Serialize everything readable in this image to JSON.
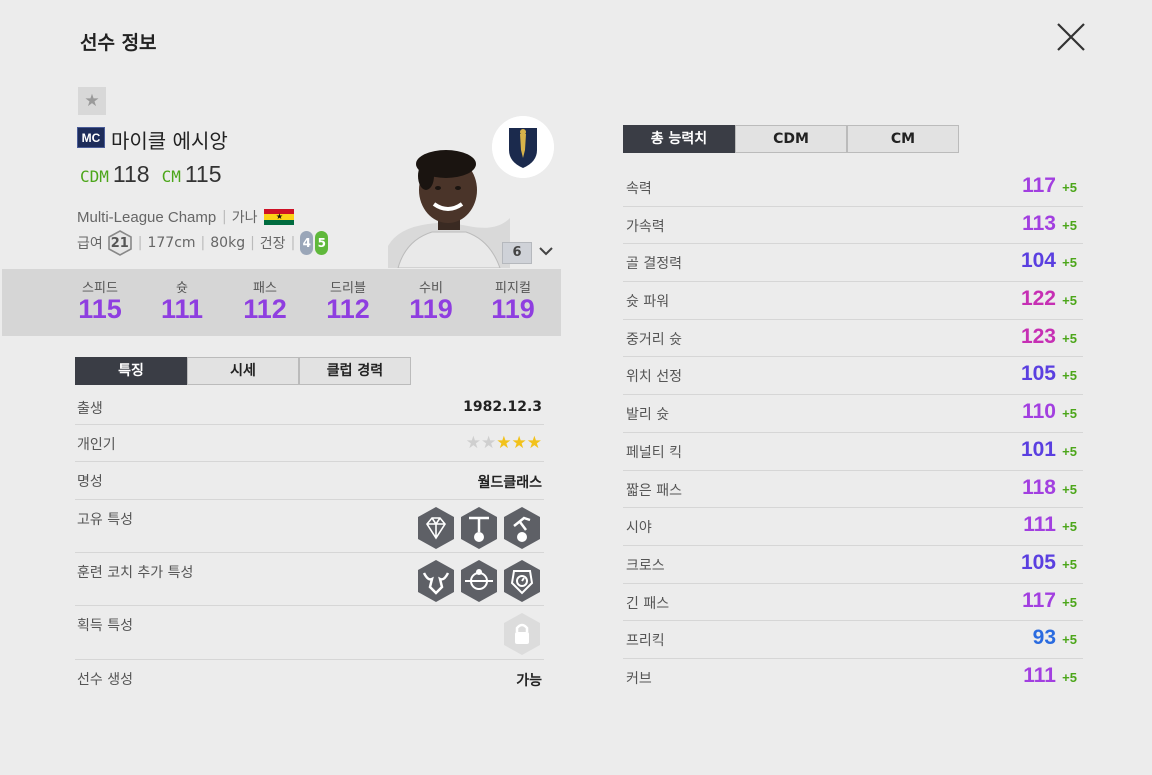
{
  "window": {
    "title": "선수 정보"
  },
  "player": {
    "season_badge": "MC",
    "name": "마이클 에시앙",
    "positions": [
      {
        "pos": "CDM",
        "ovr": "118"
      },
      {
        "pos": "CM",
        "ovr": "115"
      }
    ],
    "league": "Multi-League Champions",
    "nationality": "가나",
    "salary_label": "급여",
    "salary": "21",
    "height": "177cm",
    "weight": "80kg",
    "status_label": "건장",
    "weak_foot_left": "4",
    "strong_foot_right": "5",
    "enhance_level": "6"
  },
  "summary_stats": [
    {
      "label": "스피드",
      "value": "115"
    },
    {
      "label": "슛",
      "value": "111"
    },
    {
      "label": "패스",
      "value": "112"
    },
    {
      "label": "드리블",
      "value": "112"
    },
    {
      "label": "수비",
      "value": "119"
    },
    {
      "label": "피지컬",
      "value": "119"
    }
  ],
  "left_tabs": [
    {
      "label": "특징",
      "active": true
    },
    {
      "label": "시세",
      "active": false
    },
    {
      "label": "클럽 경력",
      "active": false
    }
  ],
  "details": {
    "birth": {
      "label": "출생",
      "value": "1982.12.3"
    },
    "popularity": {
      "label": "개인기",
      "stars": 3,
      "max": 5
    },
    "reputation": {
      "label": "명성",
      "value": "월드클래스"
    },
    "unique_traits": {
      "label": "고유 특성",
      "icons": [
        "diamond-trait-icon",
        "goalpost-trait-icon",
        "bicycle-kick-trait-icon"
      ]
    },
    "coach_traits": {
      "label": "훈련 코치 추가 특성",
      "icons": [
        "bull-trait-icon",
        "ball-center-trait-icon",
        "stopwatch-trait-icon"
      ]
    },
    "acquired_traits": {
      "label": "획득 특성",
      "icons": [
        "lock-icon"
      ]
    },
    "creation": {
      "label": "선수 생성",
      "value": "가능"
    }
  },
  "right_tabs": [
    {
      "label": "총 능력치",
      "active": true
    },
    {
      "label": "CDM",
      "active": false
    },
    {
      "label": "CM",
      "active": false
    }
  ],
  "attributes": [
    {
      "label": "속력",
      "value": "117",
      "bonus": "+5",
      "color": "#a23fe0"
    },
    {
      "label": "가속력",
      "value": "113",
      "bonus": "+5",
      "color": "#a23fe0"
    },
    {
      "label": "골 결정력",
      "value": "104",
      "bonus": "+5",
      "color": "#5a3fe0"
    },
    {
      "label": "슛 파워",
      "value": "122",
      "bonus": "+5",
      "color": "#c62fb4"
    },
    {
      "label": "중거리 슛",
      "value": "123",
      "bonus": "+5",
      "color": "#c62fb4"
    },
    {
      "label": "위치 선정",
      "value": "105",
      "bonus": "+5",
      "color": "#5a3fe0"
    },
    {
      "label": "발리 슛",
      "value": "110",
      "bonus": "+5",
      "color": "#a23fe0"
    },
    {
      "label": "페널티 킥",
      "value": "101",
      "bonus": "+5",
      "color": "#5a3fe0"
    },
    {
      "label": "짧은 패스",
      "value": "118",
      "bonus": "+5",
      "color": "#a23fe0"
    },
    {
      "label": "시야",
      "value": "111",
      "bonus": "+5",
      "color": "#a23fe0"
    },
    {
      "label": "크로스",
      "value": "105",
      "bonus": "+5",
      "color": "#5a3fe0"
    },
    {
      "label": "긴 패스",
      "value": "117",
      "bonus": "+5",
      "color": "#a23fe0"
    },
    {
      "label": "프리킥",
      "value": "93",
      "bonus": "+5",
      "color": "#2a6be0"
    },
    {
      "label": "커브",
      "value": "111",
      "bonus": "+5",
      "color": "#a23fe0"
    }
  ]
}
